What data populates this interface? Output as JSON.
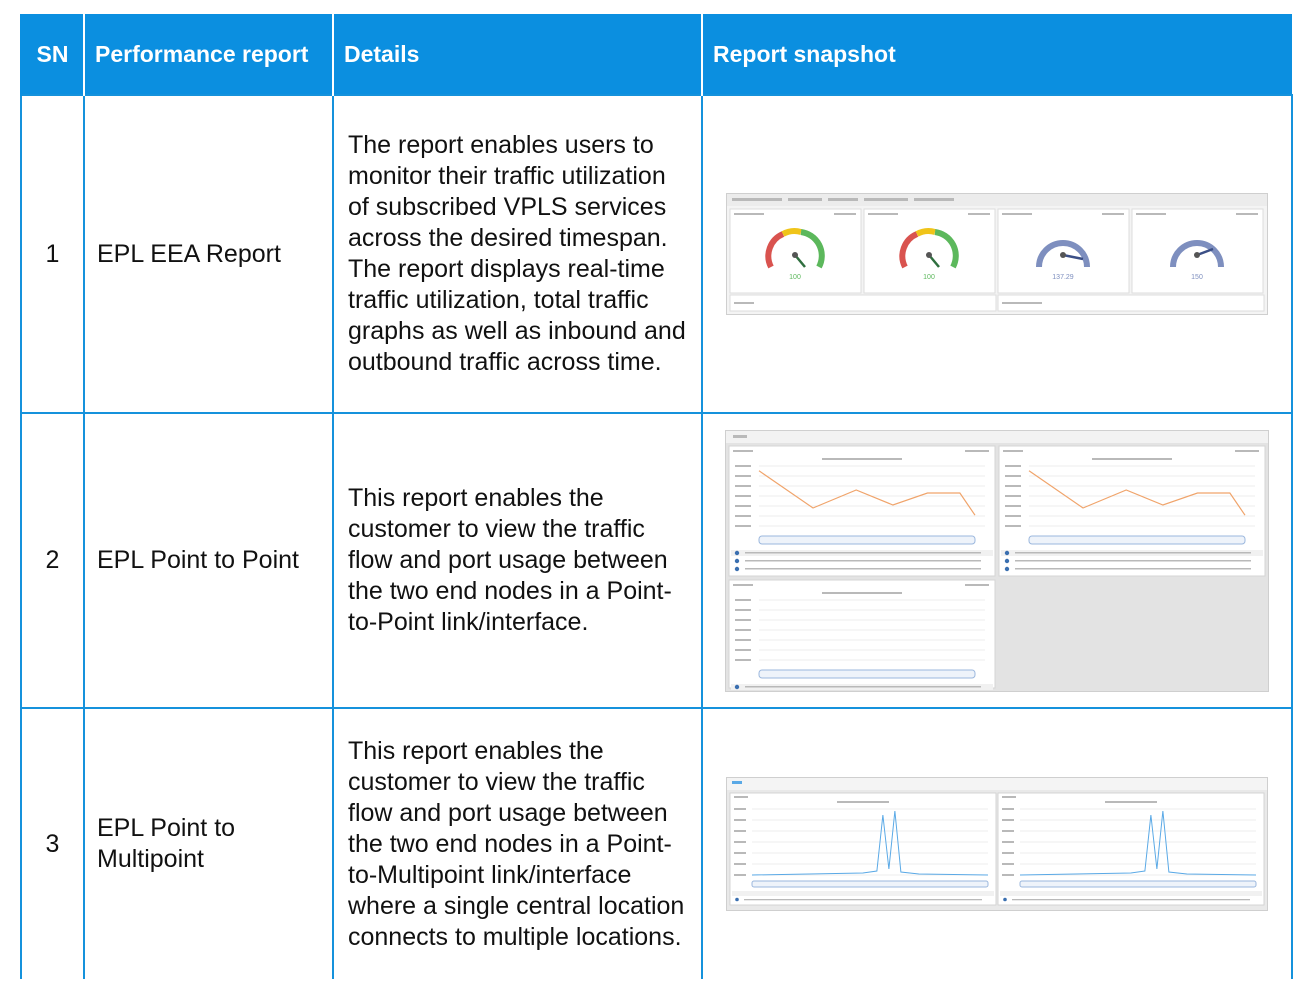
{
  "table": {
    "headers": {
      "sn": "SN",
      "report": "Performance report",
      "details": "Details",
      "snapshot": "Report snapshot"
    },
    "rows": [
      {
        "sn": "1",
        "report": "EPL EEA Report",
        "details": "The report enables users to monitor their traffic utilization of subscribed VPLS services across the desired timespan. The report displays real-time traffic utilization, total traffic graphs as well as inbound and outbound traffic across time.",
        "snapshot": {
          "gauges": [
            {
              "value_label": "100",
              "color": "#5cb85c"
            },
            {
              "value_label": "100",
              "color": "#5cb85c"
            },
            {
              "value_label": "137.29",
              "color": "#7e8fbf"
            },
            {
              "value_label": "150",
              "color": "#7e8fbf"
            }
          ]
        }
      },
      {
        "sn": "2",
        "report": "EPL Point to Point",
        "details": "This report enables the customer to view the traffic flow and port usage between the two end nodes in a Point-to-Point link/interface.",
        "snapshot": {
          "line_color": "#f0a46b"
        }
      },
      {
        "sn": "3",
        "report": "EPL Point to Multipoint",
        "details": "This report enables the customer to view the traffic flow and port usage between the two end nodes in a Point-to-Multipoint link/interface where a single central location connects to multiple locations.",
        "snapshot": {
          "line_color": "#5aa9e6"
        }
      }
    ]
  },
  "colors": {
    "header_bg": "#0b8fe0",
    "border": "#1592dc"
  }
}
